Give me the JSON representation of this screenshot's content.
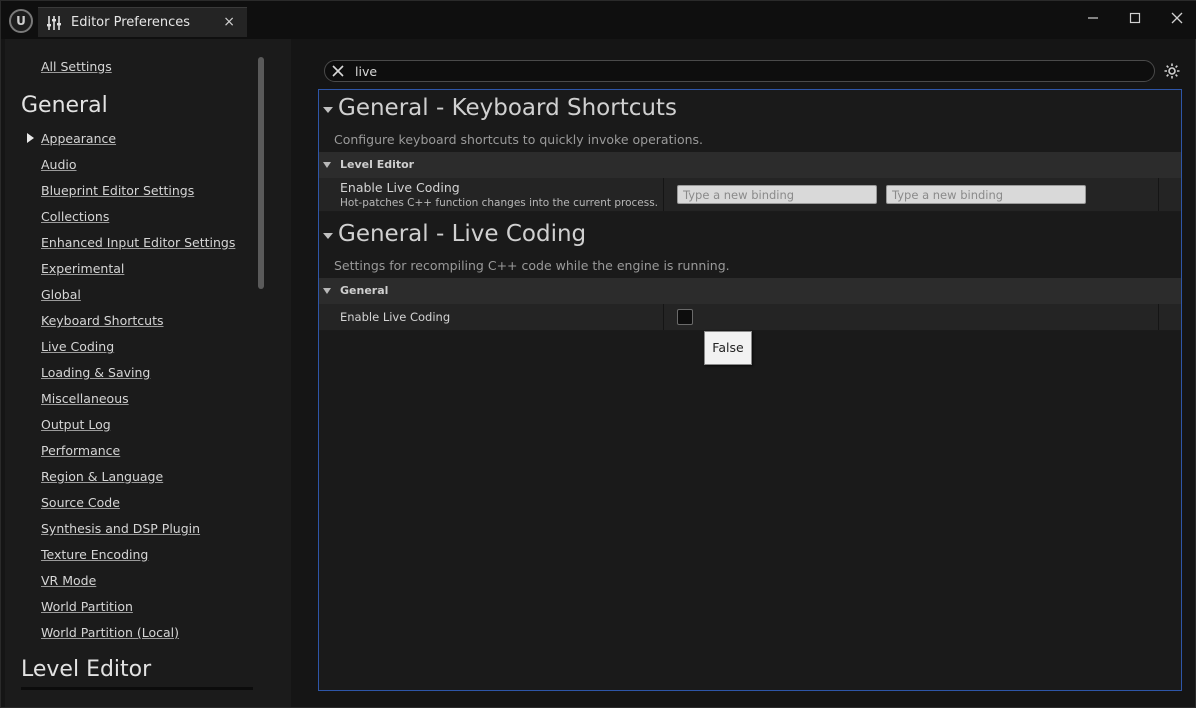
{
  "window": {
    "tab_title": "Editor Preferences",
    "tab_close": "×"
  },
  "sidebar": {
    "all_settings": "All Settings",
    "heading_general": "General",
    "items": [
      {
        "label": "Appearance",
        "selected": true
      },
      {
        "label": "Audio"
      },
      {
        "label": "Blueprint Editor Settings"
      },
      {
        "label": "Collections"
      },
      {
        "label": "Enhanced Input Editor Settings"
      },
      {
        "label": "Experimental"
      },
      {
        "label": "Global"
      },
      {
        "label": "Keyboard Shortcuts"
      },
      {
        "label": "Live Coding"
      },
      {
        "label": "Loading & Saving"
      },
      {
        "label": "Miscellaneous"
      },
      {
        "label": "Output Log"
      },
      {
        "label": "Performance"
      },
      {
        "label": "Region & Language"
      },
      {
        "label": "Source Code"
      },
      {
        "label": "Synthesis and DSP Plugin"
      },
      {
        "label": "Texture Encoding"
      },
      {
        "label": "VR Mode"
      },
      {
        "label": "World Partition"
      },
      {
        "label": "World Partition (Local)"
      }
    ],
    "heading_level_editor": "Level Editor"
  },
  "search": {
    "value": "live"
  },
  "sections": [
    {
      "title": "General - Keyboard Shortcuts",
      "description": "Configure keyboard shortcuts to quickly invoke operations.",
      "category": "Level Editor",
      "property": {
        "name": "Enable Live Coding",
        "subtitle": "Hot-patches C++ function changes into the current process.",
        "binding_placeholder_1": "Type a new binding",
        "binding_placeholder_2": "Type a new binding"
      }
    },
    {
      "title": "General - Live Coding",
      "description": "Settings for recompiling C++ code while the engine is running.",
      "category": "General",
      "property": {
        "name": "Enable Live Coding",
        "value": false
      }
    }
  ],
  "tooltip": {
    "text": "False"
  },
  "colors": {
    "accent_border": "#2e56a8",
    "background": "#151515",
    "panel": "#1a1a1a"
  }
}
